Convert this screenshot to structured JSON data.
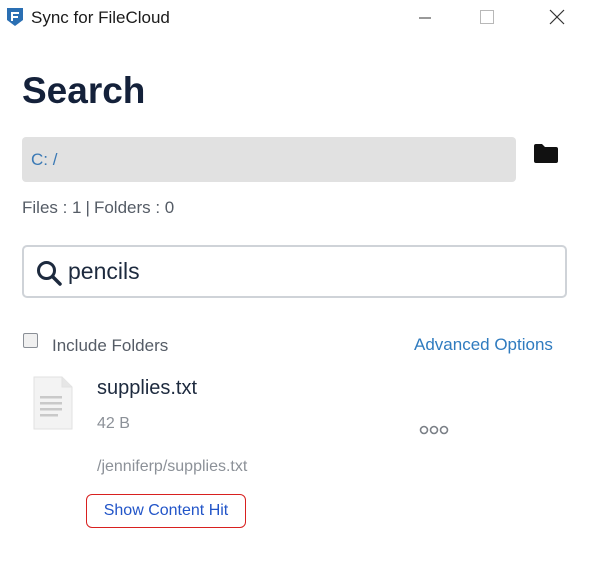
{
  "window": {
    "title": "Sync for FileCloud",
    "icons": {
      "logo": "filecloud-logo-icon",
      "minimize": "minimize-icon",
      "maximize": "maximize-icon",
      "close": "close-icon"
    }
  },
  "header": {
    "title": "Search"
  },
  "path_bar": {
    "value": "C: /",
    "folder_icon": "folder-icon"
  },
  "counts": {
    "files": "Files : 1",
    "separator": "|",
    "folders": "Folders : 0"
  },
  "search": {
    "value": "pencils",
    "icon": "search-icon"
  },
  "options": {
    "include_folders_label": "Include Folders",
    "include_folders_checked": false,
    "advanced_label": "Advanced Options"
  },
  "results": [
    {
      "name": "supplies.txt",
      "size": "42 B",
      "path": "/jenniferp/supplies.txt",
      "icon": "text-file-icon",
      "more_icon": "more-options-icon",
      "content_hit_label": "Show Content Hit"
    }
  ],
  "colors": {
    "accent": "#2f7bbf",
    "title": "#14213a",
    "highlight_border": "#d8201f",
    "path_bg": "#e1e1e1"
  }
}
